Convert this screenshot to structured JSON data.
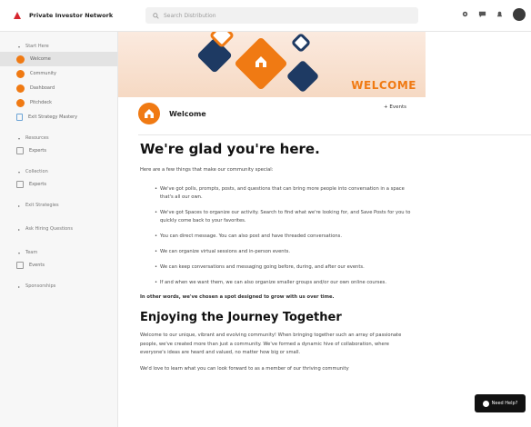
{
  "header": {
    "brand": "Private Investor Network",
    "search_placeholder": "Search Distribution"
  },
  "sidebar": {
    "start_here": "Start Here",
    "items": [
      {
        "label": "Welcome",
        "active": true
      },
      {
        "label": "Community"
      },
      {
        "label": "Dashboard"
      },
      {
        "label": "Pitchdeck"
      },
      {
        "label": "Exit Strategy Mastery"
      }
    ],
    "sections": [
      {
        "label": "Resources",
        "child": "Experts"
      },
      {
        "label": "Collection",
        "child": "Experts"
      },
      {
        "label": "Exit Strategies"
      },
      {
        "label": "Ask Hiring Questions"
      },
      {
        "label": "Team",
        "child": "Events"
      },
      {
        "label": "Sponsorships"
      }
    ]
  },
  "banner": {
    "word": "WELCOME"
  },
  "page": {
    "title": "Welcome",
    "follow_label": "+ Events",
    "heading": "We're glad you're here.",
    "intro": "Here are a few things that make our community special:",
    "bullets": [
      "We've got polls, prompts, posts, and questions that can bring more people into conversation in a space that's all our own.",
      "We've got Spaces to organize our activity. Search to find what we're looking for, and Save Posts for you to quickly come back to your favorites.",
      "You can direct message. You can also post and have threaded conversations.",
      "We can organize virtual sessions and in-person events.",
      "We can keep conversations and messaging going before, during, and after our events.",
      "If and when we want them, we can also organize smaller groups and/or our own online courses."
    ],
    "closing": "In other words, we've chosen a spot designed to grow with us over time.",
    "heading2": "Enjoying the Journey Together",
    "para2": "Welcome to our unique, vibrant and evolving community! When bringing together such an array of passionate people, we've created more than just a community. We've formed a dynamic hive of collaboration, where everyone's ideas are heard and valued, no matter how big or small.",
    "para3": "We'd love to learn what you can look forward to as a member of our thriving community"
  },
  "help": {
    "label": "Need Help?"
  },
  "colors": {
    "accent": "#f07a13",
    "navy": "#1e3a63"
  }
}
